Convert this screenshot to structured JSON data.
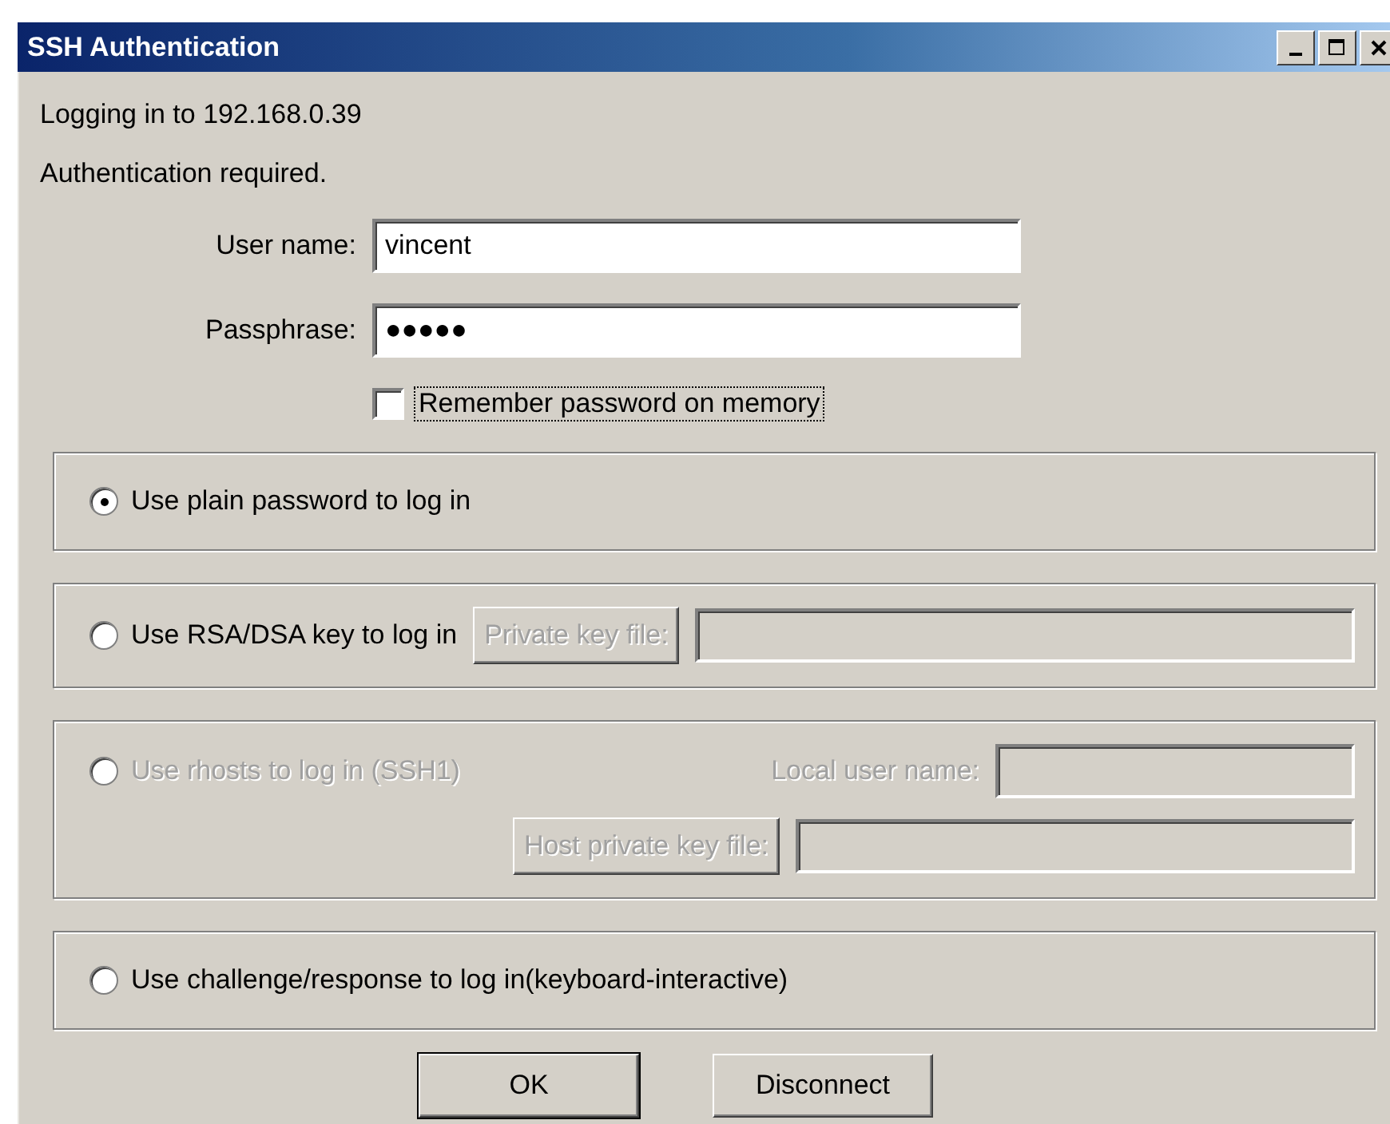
{
  "window": {
    "title": "SSH Authentication"
  },
  "status_lines": [
    "Logging in to 192.168.0.39",
    "Authentication required."
  ],
  "fields": [
    {
      "label": "User name:",
      "value": "vincent"
    },
    {
      "label": "Passphrase:",
      "value": "●●●●●"
    }
  ],
  "remember": {
    "label": "Remember password on memory",
    "checked": false,
    "focused": true
  },
  "methods": [
    {
      "label": "Use plain password to log in",
      "selected": true,
      "disabled": false
    },
    {
      "label": "Use RSA/DSA key to log in",
      "selected": false,
      "disabled": false,
      "options": [
        {
          "kind": "button",
          "label": "Private key file:",
          "disabled": true
        }
      ]
    },
    {
      "label": "Use rhosts to log in (SSH1)",
      "selected": false,
      "disabled": true,
      "options": [
        {
          "kind": "label",
          "label": "Local user name:",
          "disabled": true
        },
        {
          "kind": "button",
          "label": "Host private key file:",
          "disabled": true
        }
      ]
    },
    {
      "label": "Use challenge/response to log in(keyboard-interactive)",
      "selected": false,
      "disabled": false
    }
  ],
  "buttons": [
    {
      "label": "OK",
      "default": true
    },
    {
      "label": "Disconnect",
      "default": false
    }
  ]
}
